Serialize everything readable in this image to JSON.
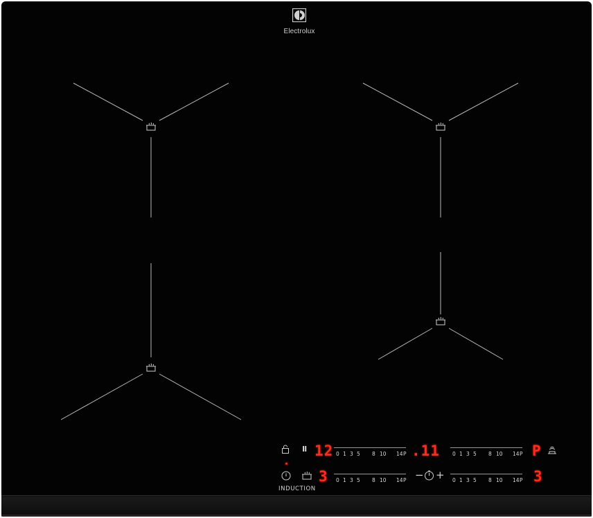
{
  "brand": {
    "name": "Electrolux",
    "logo_icon": "electrolux-logo-icon"
  },
  "cooking_zones": [
    {
      "id": "front-left",
      "icon": "pot-icon"
    },
    {
      "id": "rear-left",
      "icon": "pot-icon"
    },
    {
      "id": "rear-right",
      "icon": "pot-icon"
    },
    {
      "id": "front-right",
      "icon": "pot-icon"
    }
  ],
  "control_panel": {
    "label": "INDUCTION",
    "zones": [
      {
        "id": "zone-1",
        "display": "12"
      },
      {
        "id": "zone-2",
        "display": ".11"
      },
      {
        "id": "zone-3",
        "display": "P"
      },
      {
        "id": "zone-4",
        "display": "3"
      }
    ],
    "left_display": "3",
    "slider_scale": [
      "0",
      "1",
      "3",
      "5",
      "8",
      "10",
      "14",
      "P"
    ],
    "icons": {
      "lock": "lock-icon",
      "pause": "pause-icon",
      "power": "power-icon",
      "pot": "pot-icon",
      "hob_to_hood": "hob2hood-icon",
      "timer": "timer-icon",
      "minus": "minus-icon",
      "plus": "plus-icon"
    },
    "glyphs": {
      "minus": "−",
      "plus": "+",
      "pause": "II"
    }
  },
  "colors": {
    "glass": "#030303",
    "display_red": "#ff2a1a",
    "marking_gray": "#b8b8b8"
  }
}
